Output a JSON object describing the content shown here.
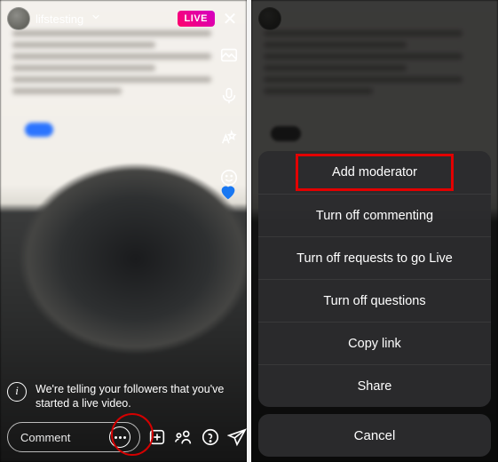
{
  "left": {
    "username": "lifstesting",
    "live_badge": "LIVE",
    "toast": "We're telling your followers that you've started a live video.",
    "comment_placeholder": "Comment",
    "icons": {
      "chevron": "chevron-down-icon",
      "close": "close-icon",
      "image": "image-icon",
      "mic": "microphone-icon",
      "effects": "effects-icon",
      "smiley": "smiley-icon",
      "more": "more-icon",
      "add_media": "add-media-icon",
      "invite": "invite-guest-icon",
      "question": "question-icon",
      "send": "send-icon",
      "info": "info-icon",
      "heart": "heart-icon"
    }
  },
  "right": {
    "sheet": {
      "items": [
        "Add moderator",
        "Turn off commenting",
        "Turn off requests to go Live",
        "Turn off questions",
        "Copy link",
        "Share"
      ],
      "cancel": "Cancel"
    }
  },
  "colors": {
    "highlight": "#e30000",
    "live_gradient_a": "#ff0169",
    "live_gradient_b": "#d300c5"
  }
}
